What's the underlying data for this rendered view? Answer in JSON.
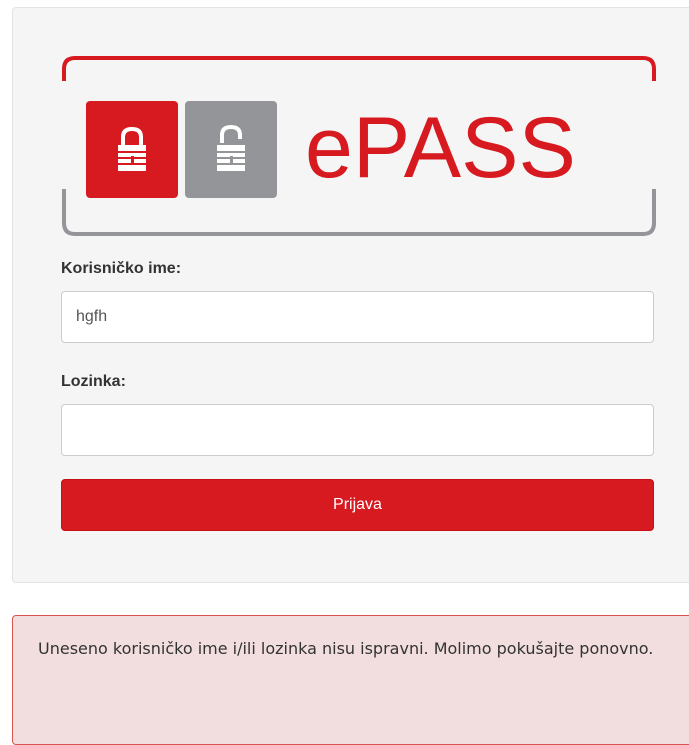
{
  "logo": {
    "brand_text": "ePASS",
    "colors": {
      "red": "#d71920",
      "gray": "#939598"
    }
  },
  "form": {
    "username_label": "Korisničko ime:",
    "username_value": "hgfh",
    "password_label": "Lozinka:",
    "password_value": "",
    "submit_label": "Prijava"
  },
  "alert": {
    "message": "Uneseno korisničko ime i/ili lozinka nisu ispravni. Molimo pokušajte ponovno.",
    "type": "error"
  }
}
